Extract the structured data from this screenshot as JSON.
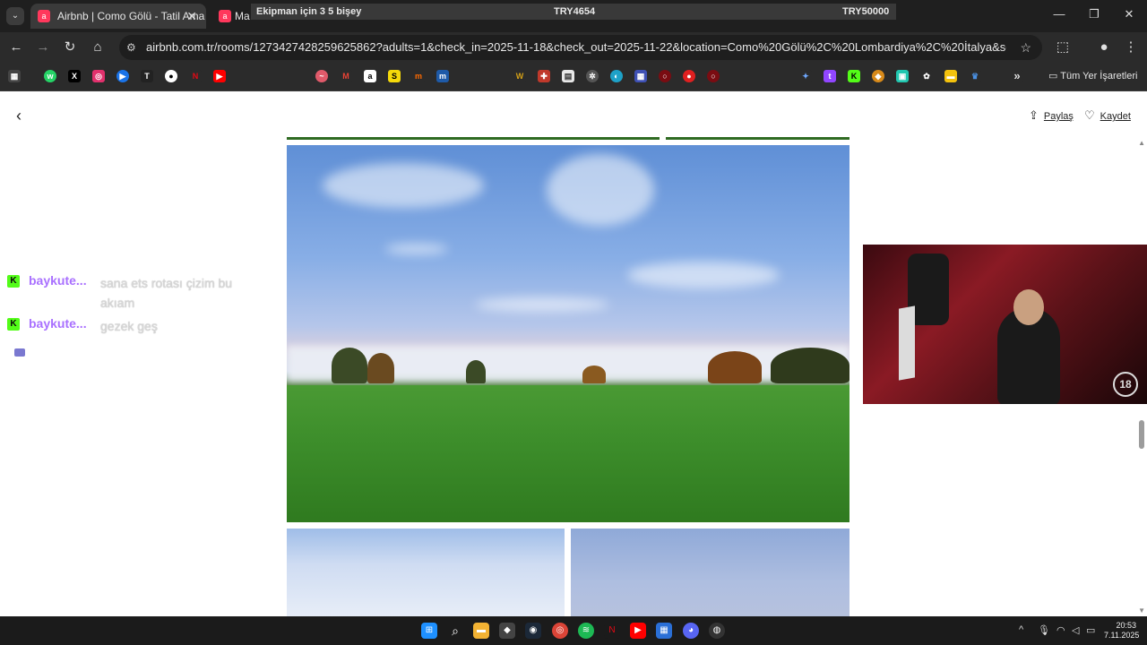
{
  "browser": {
    "tabs": [
      {
        "label": "Airbnb | Como Gölü - Tatil Ama",
        "close": "✕"
      },
      {
        "label": "Ma"
      }
    ],
    "overlay": {
      "text": "Ekipman için 3 5 bişey",
      "goal1": "TRY4654",
      "goal2": "TRY50000"
    },
    "url": "airbnb.com.tr/rooms/1273427428259625862?adults=1&check_in=2025-11-18&check_out=2025-11-22&location=Como%20Gölü%2C%20Lombardiya%2C%20İtalya&search_mode=r...",
    "bookmarks_folder": "Tüm Yer İşaretleri"
  },
  "page": {
    "share_label": "Paylaş",
    "save_label": "Kaydet"
  },
  "chat": {
    "messages": [
      {
        "user": "baykute...",
        "text": "sana ets rotası çizim bu akıam"
      },
      {
        "user": "baykute...",
        "text": "gezek geş"
      }
    ]
  },
  "webcam": {
    "age_badge": "18"
  },
  "taskbar": {
    "time": "20:53",
    "date": "7.11.2025"
  },
  "colors": {
    "accent": "#ff385c",
    "kick_green": "#53fc18",
    "chat_user": "#a970ff"
  }
}
